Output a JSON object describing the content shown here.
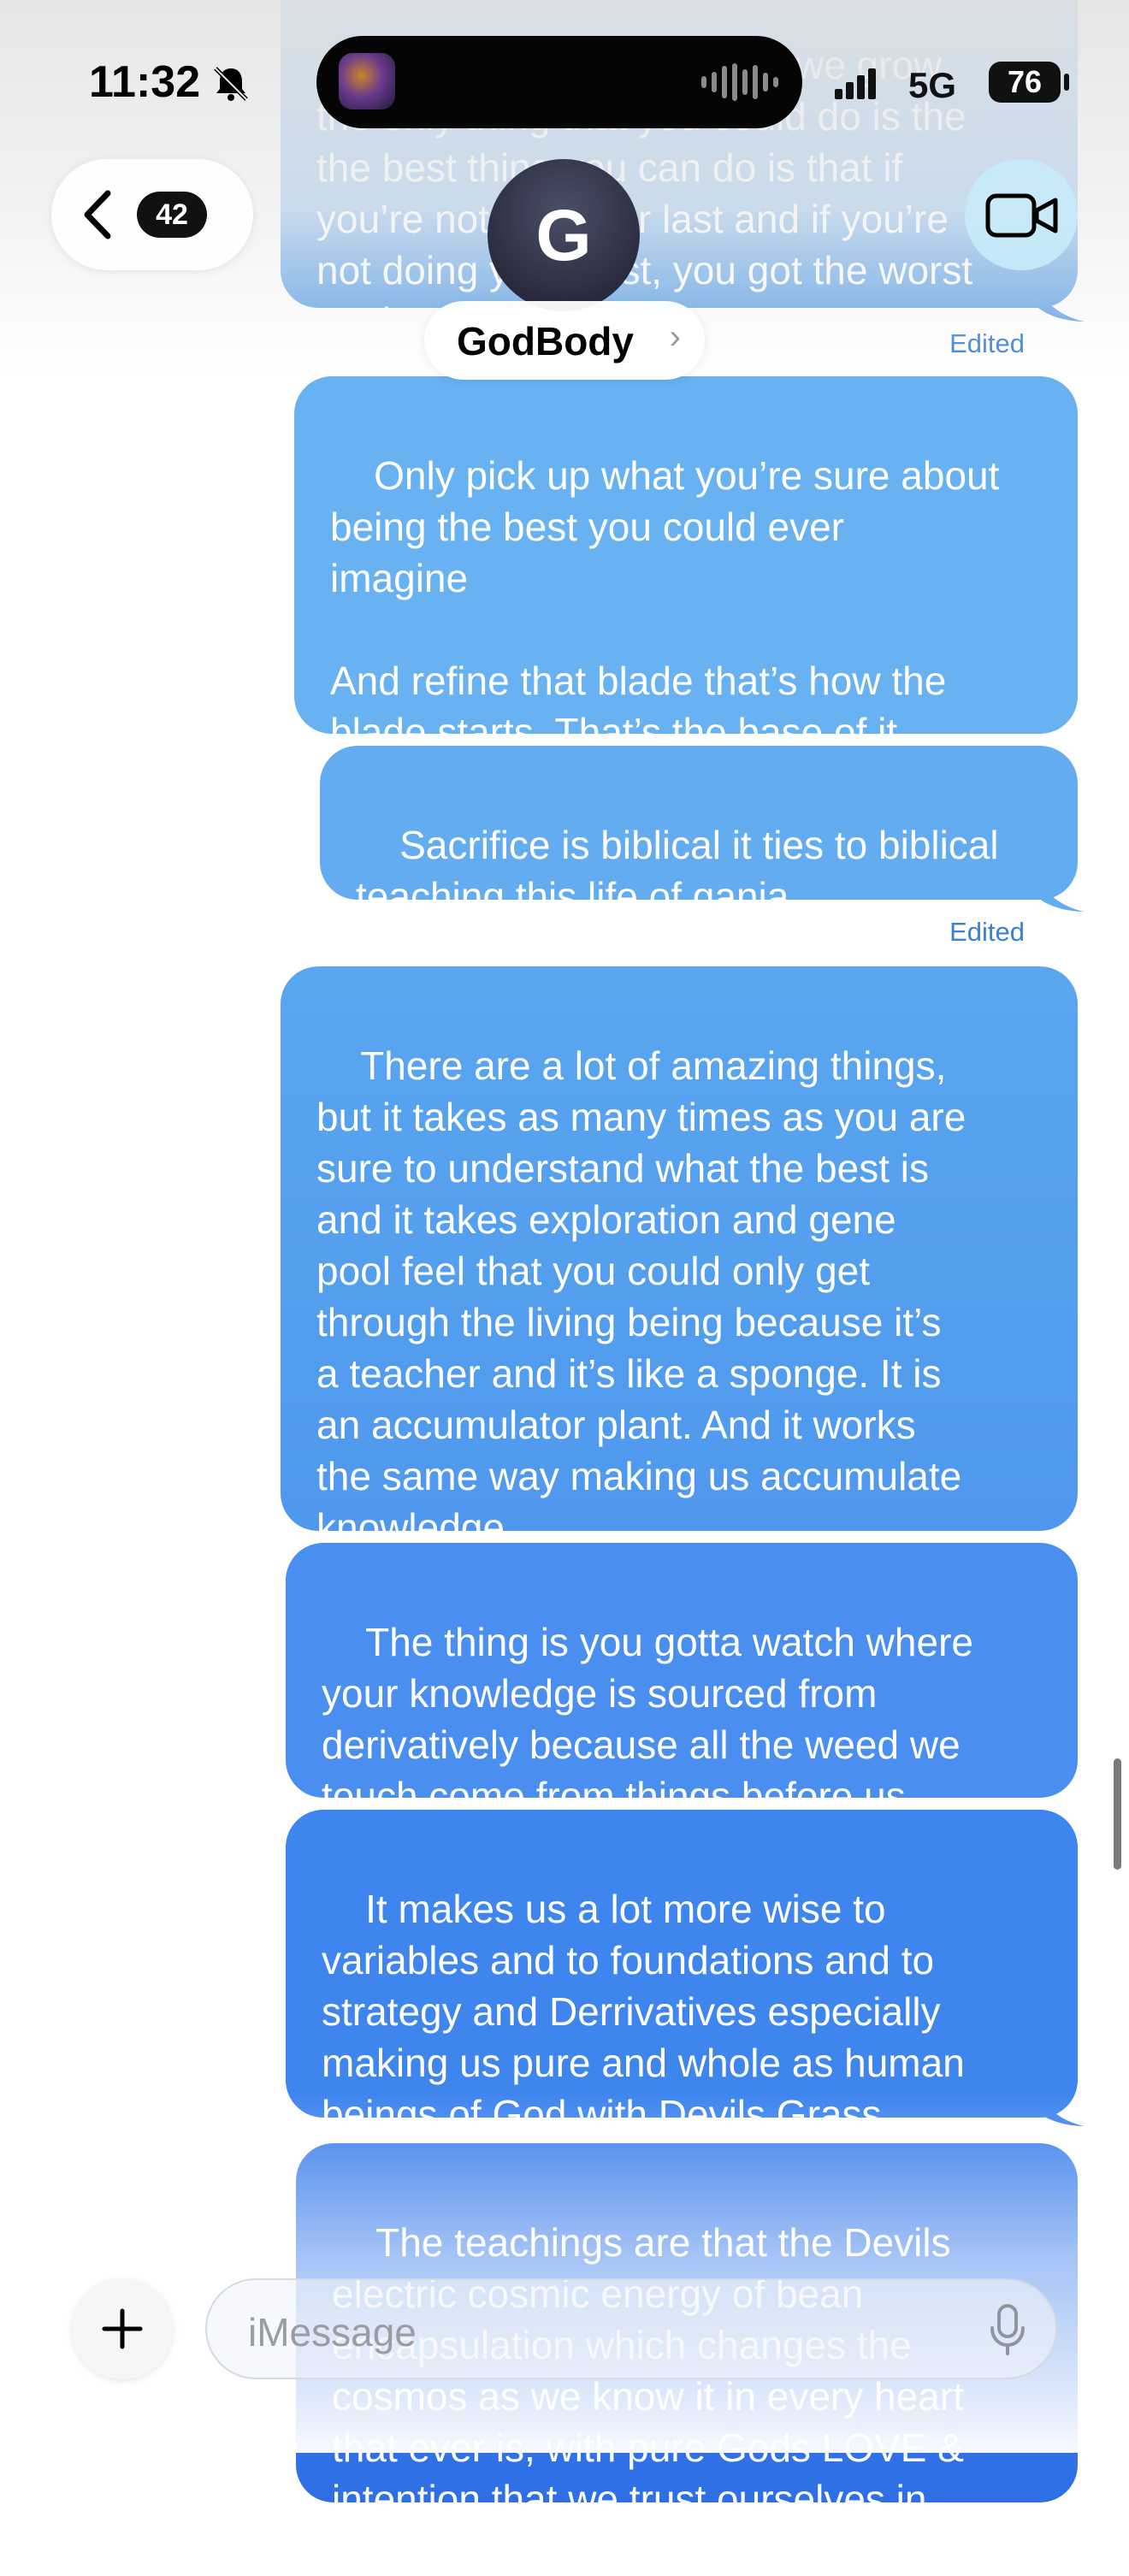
{
  "status_bar": {
    "time": "11:32",
    "network": "5G",
    "battery": "76",
    "icons": [
      "bell-slash-icon",
      "signal-icon",
      "battery-icon"
    ]
  },
  "header": {
    "back_count": "42",
    "contact_initial": "G",
    "contact_name": "GodBody",
    "chevron": "›"
  },
  "messages": [
    {
      "id": "m0",
      "text": "times encapsulation that we grow\nthe only thing that you could do is the\nthe best thing you can do is that if\nyou’re not first your last and if you’re\nnot doing your best, you got the worst\nso don’t ever pick it up",
      "edited": "Edited"
    },
    {
      "id": "m1",
      "text": "Only pick up what you’re sure about\nbeing the best you could ever\nimagine\n\nAnd refine that blade that’s how the\nblade starts. That’s the base of it.",
      "edited": ""
    },
    {
      "id": "m2",
      "text": "Sacrifice is biblical it ties to biblical\nteaching this life of ganja",
      "edited": "Edited"
    },
    {
      "id": "m3",
      "text": "There are a lot of amazing things,\nbut it takes as many times as you are\nsure to understand what the best is\nand it takes exploration and gene\npool feel that you could only get\nthrough the living being because it’s\na teacher and it’s like a sponge. It is\nan accumulator plant. And it works\nthe same way making us accumulate\nknowledge.",
      "edited": ""
    },
    {
      "id": "m4",
      "text": "The thing is you gotta watch where\nyour knowledge is sourced from\nderivatively because all the weed we\ntouch come from things before us",
      "edited": ""
    },
    {
      "id": "m5",
      "text": "It makes us a lot more wise to\nvariables and to foundations and to\nstrategy and Derrivatives especially\nmaking us pure and whole as human\nbeings of God with Devils Grass",
      "edited": ""
    },
    {
      "id": "m6",
      "text": "The teachings are that the Devils\nelectric cosmic energy of bean\nencapsulation which changes the\ncosmos as we know it in every heart\nthat ever is, with pure Gods LOVE &\nintention that we trust ourselves in",
      "edited": ""
    }
  ],
  "composer": {
    "placeholder": "iMessage"
  },
  "colors": {
    "bubble_top": "#6ab6f3",
    "bubble_bottom": "#2f6fe6",
    "edited_label": "#3b7fd6"
  }
}
